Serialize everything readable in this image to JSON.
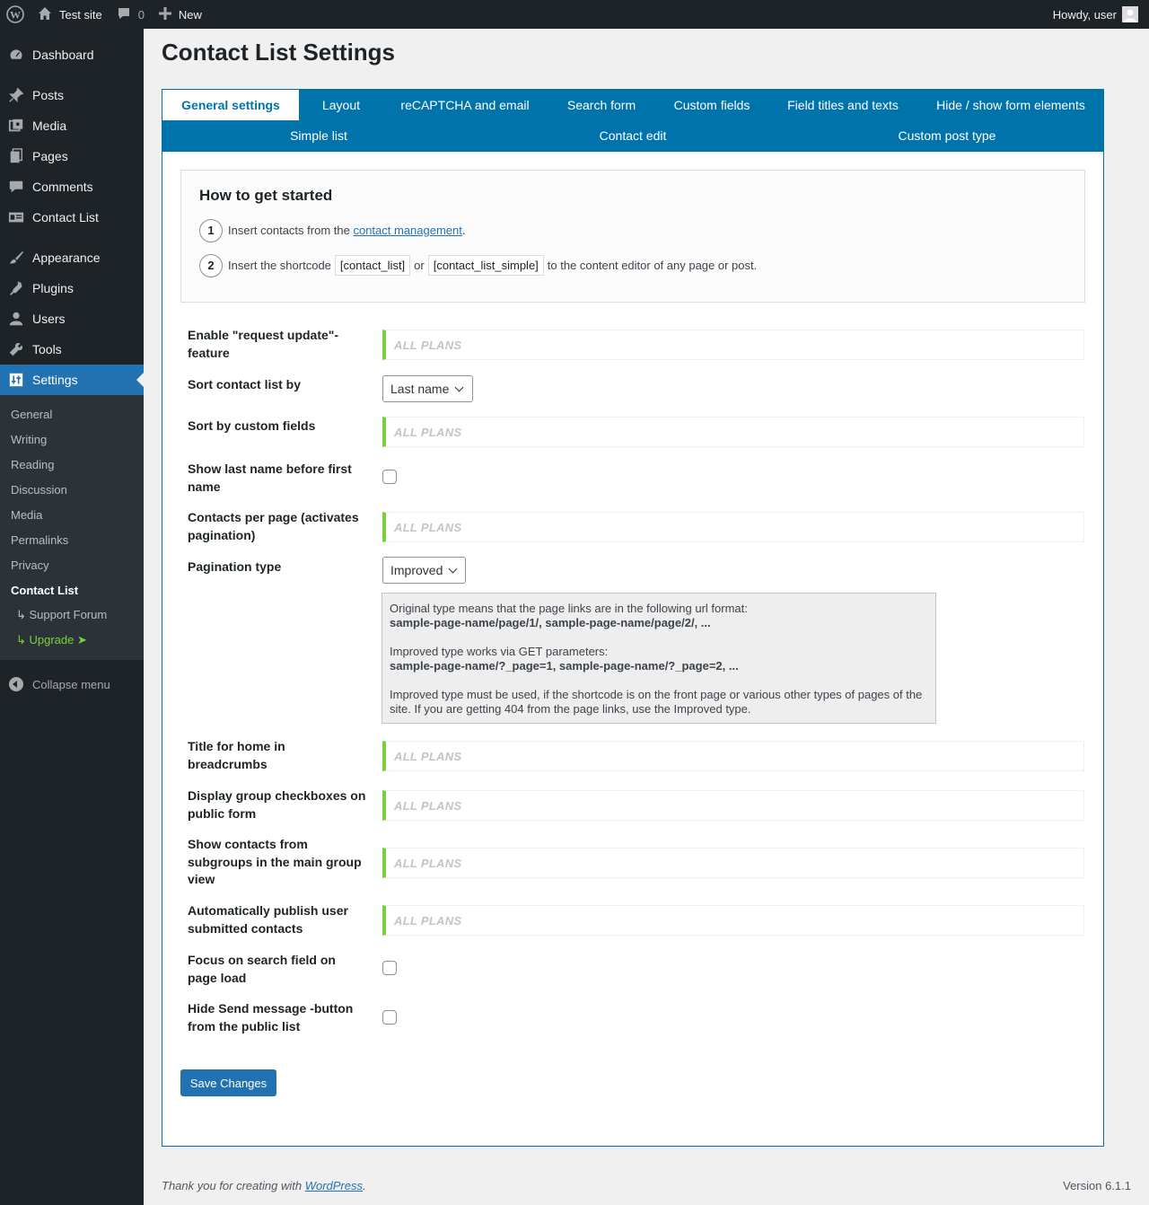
{
  "adminbar": {
    "site_name": "Test site",
    "comments_count": "0",
    "new_label": "New",
    "howdy": "Howdy, user"
  },
  "sidebar": {
    "items": [
      {
        "label": "Dashboard",
        "icon": "dashboard-icon"
      },
      {
        "label": "Posts",
        "icon": "pin-icon"
      },
      {
        "label": "Media",
        "icon": "media-icon"
      },
      {
        "label": "Pages",
        "icon": "pages-icon"
      },
      {
        "label": "Comments",
        "icon": "comment-icon"
      },
      {
        "label": "Contact List",
        "icon": "id-card-icon"
      },
      {
        "label": "Appearance",
        "icon": "brush-icon"
      },
      {
        "label": "Plugins",
        "icon": "plug-icon"
      },
      {
        "label": "Users",
        "icon": "user-icon"
      },
      {
        "label": "Tools",
        "icon": "wrench-icon"
      },
      {
        "label": "Settings",
        "icon": "sliders-icon"
      }
    ],
    "submenu": [
      "General",
      "Writing",
      "Reading",
      "Discussion",
      "Media",
      "Permalinks",
      "Privacy",
      "Contact List",
      "↳ Support Forum",
      "↳ Upgrade ➤"
    ],
    "collapse_label": "Collapse menu"
  },
  "page": {
    "title": "Contact List Settings"
  },
  "tabs": {
    "row1": [
      "General settings",
      "Layout",
      "reCAPTCHA and email",
      "Search form",
      "Custom fields",
      "Field titles and texts",
      "Hide / show form elements"
    ],
    "row2": [
      "Simple list",
      "Contact edit",
      "Custom post type"
    ]
  },
  "getting_started": {
    "title": "How to get started",
    "step1_num": "1",
    "step1_text": "Insert contacts from the",
    "step1_link": "contact management",
    "step1_end": ".",
    "step2_num": "2",
    "step2_text": "Insert the shortcode",
    "step2_code1": "[contact_list]",
    "step2_or": "or",
    "step2_code2": "[contact_list_simple]",
    "step2_end": "to the content editor of any page or post."
  },
  "settings": {
    "all_plans": "ALL PLANS",
    "request_update": "Enable \"request update\"-feature",
    "sort_by": "Sort contact list by",
    "sort_by_value": "Last name",
    "sort_custom": "Sort by custom fields",
    "last_name_first": "Show last name before first name",
    "per_page": "Contacts per page (activates pagination)",
    "pagination_type": "Pagination type",
    "pagination_value": "Improved",
    "info_line1": "Original type means that the page links are in the following url format:",
    "info_line1_bold": "sample-page-name/page/1/, sample-page-name/page/2/, ...",
    "info_line2": "Improved type works via GET parameters:",
    "info_line2_bold": "sample-page-name/?_page=1, sample-page-name/?_page=2, ...",
    "info_line3": "Improved type must be used, if the shortcode is on the front page or various other types of pages of the site. If you are getting 404 from the page links, use the Improved type.",
    "home_title": "Title for home in breadcrumbs",
    "group_checkboxes": "Display group checkboxes on public form",
    "subgroups": "Show contacts from subgroups in the main group view",
    "auto_publish": "Automatically publish user submitted contacts",
    "focus_search": "Focus on search field on page load",
    "hide_send": "Hide Send message -button from the public list",
    "save_label": "Save Changes"
  },
  "footer": {
    "thanks": "Thank you for creating with",
    "link": "WordPress",
    "end": ".",
    "version": "Version 6.1.1"
  },
  "colors": {
    "accent": "#2271b1",
    "tabs_bg": "#0073aa",
    "sidebar_bg": "#1d2327",
    "plans_border": "#7ad03a"
  }
}
